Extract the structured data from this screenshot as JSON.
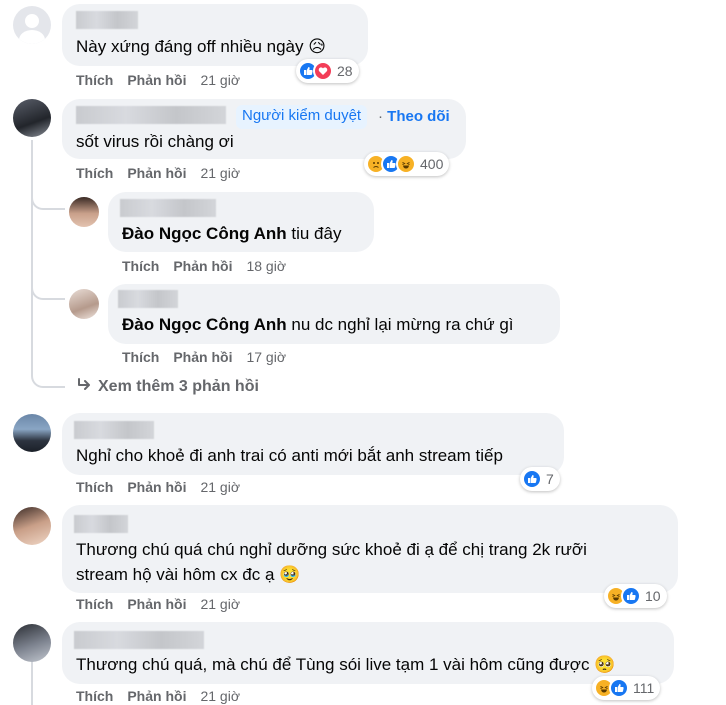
{
  "labels": {
    "like": "Thích",
    "reply": "Phản hồi"
  },
  "comments": [
    {
      "text": "Này xứng đáng off nhiều ngày",
      "emoji": "😥",
      "time": "21 giờ",
      "reactions": "28"
    },
    {
      "moderator_badge": "Người kiểm duyệt",
      "follow": "Theo dõi",
      "text": "sốt virus rồi chàng ơi",
      "time": "21 giờ",
      "reactions": "400"
    },
    {
      "mention": "Đào Ngọc Công Anh",
      "text": "tiu đây",
      "time": "18 giờ"
    },
    {
      "mention": "Đào Ngọc Công Anh",
      "text": "nu dc nghỉ lại mừng ra chứ gì",
      "time": "17 giờ"
    },
    {
      "text": "Nghỉ cho khoẻ đi anh trai có anti mới bắt anh stream tiếp",
      "time": "21 giờ",
      "reactions": "7"
    },
    {
      "text_line1": "Thương chú quá chú nghỉ dưỡng sức khoẻ đi ạ để chị trang 2k rưỡi",
      "text_line2": "stream hộ vài hôm cx đc ạ",
      "emoji": "🥹",
      "time": "21 giờ",
      "reactions": "10"
    },
    {
      "text": "Thương chú quá, mà chú để Tùng sói live tạm 1 vài hôm cũng được",
      "emoji": "🥺",
      "time": "21 giờ",
      "reactions": "111"
    }
  ],
  "more_replies": "Xem thêm 3 phản hồi",
  "colors": {
    "like": "#1877f2",
    "love": "#f33e58",
    "haha": "#f7b125",
    "link": "#385898"
  }
}
